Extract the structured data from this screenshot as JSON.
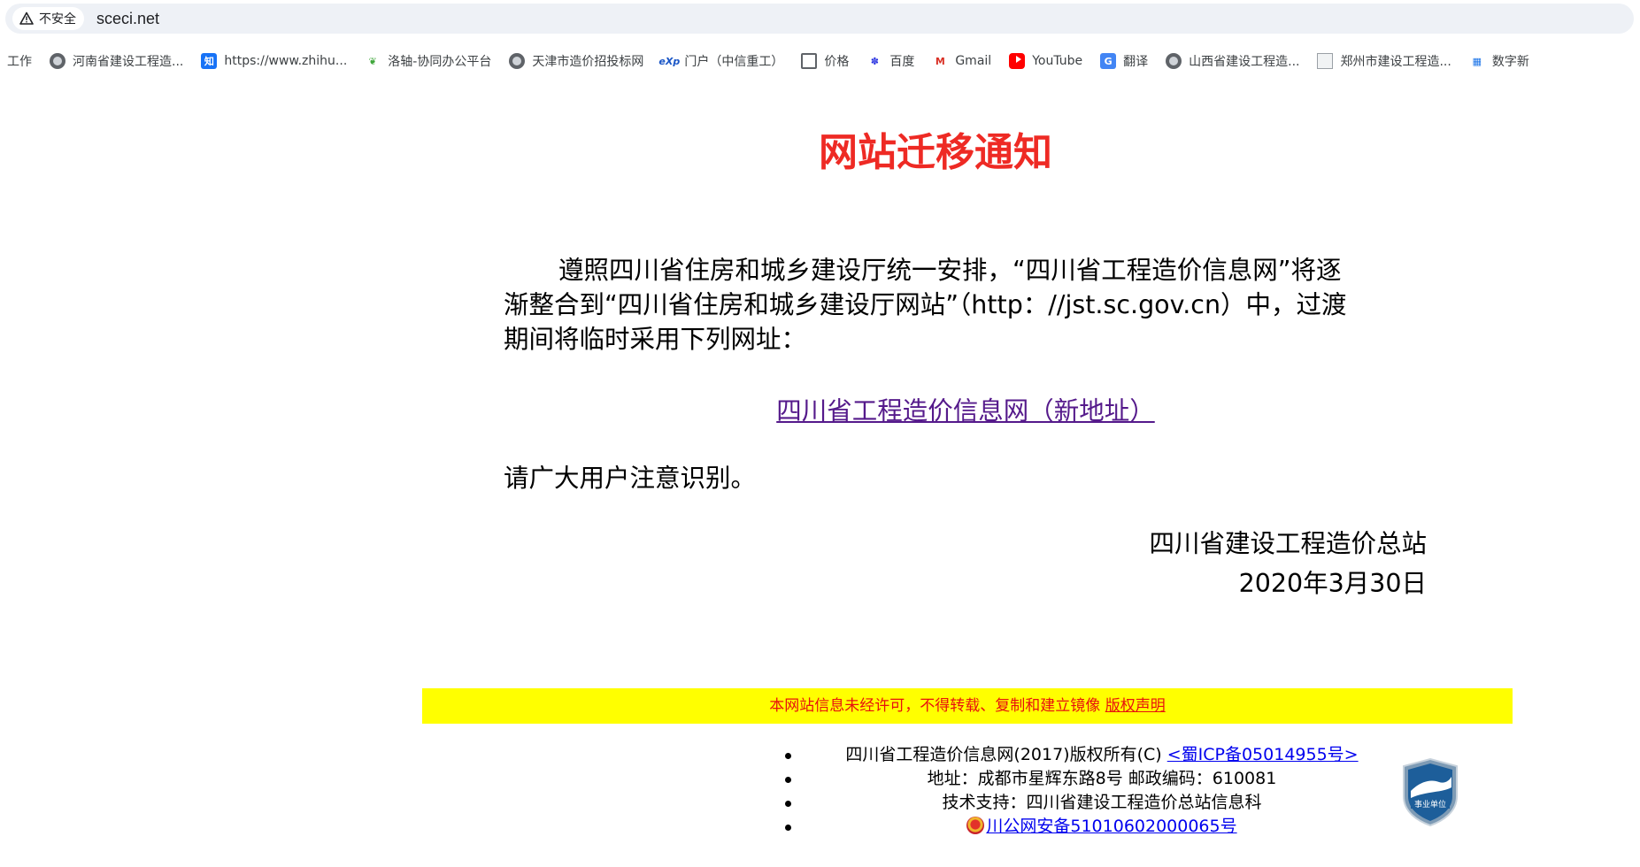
{
  "browser": {
    "security_label": "不安全",
    "url": "sceci.net",
    "bookmarks": [
      {
        "label": "工作",
        "icon": "none"
      },
      {
        "label": "河南省建设工程造...",
        "icon": "globe-icon"
      },
      {
        "label": "https://www.zhihu...",
        "icon": "zhihu-icon"
      },
      {
        "label": "洛轴-协同办公平台",
        "icon": "butterfly-icon"
      },
      {
        "label": "天津市造价招投标网",
        "icon": "globe-icon"
      },
      {
        "label": "门户（中信重工）",
        "icon": "exp-icon"
      },
      {
        "label": "价格",
        "icon": "folder-icon"
      },
      {
        "label": "百度",
        "icon": "baidu-icon"
      },
      {
        "label": "Gmail",
        "icon": "gmail-icon"
      },
      {
        "label": "YouTube",
        "icon": "youtube-icon"
      },
      {
        "label": "翻译",
        "icon": "translate-icon"
      },
      {
        "label": "山西省建设工程造...",
        "icon": "globe-icon"
      },
      {
        "label": "郑州市建设工程造...",
        "icon": "document-icon"
      },
      {
        "label": "数字新",
        "icon": "shuzi-icon"
      }
    ]
  },
  "notice": {
    "title": "网站迁移通知",
    "line1": "遵照四川省住房和城乡建设厅统一安排，“四川省工程造价信息网”将逐",
    "line2": "渐整合到“四川省住房和城乡建设厅网站”（http：//jst.sc.gov.cn）中，过渡",
    "line3": "期间将临时采用下列网址：",
    "new_link": "四川省工程造价信息网（新地址）",
    "reminder": "请广大用户注意识别。",
    "signature_org": "四川省建设工程造价总站",
    "signature_date": "2020年3月30日"
  },
  "footer": {
    "banner_text": "本网站信息未经许可，不得转载、复制和建立镜像 ",
    "banner_link": "版权声明",
    "copyright_prefix": "四川省工程造价信息网(2017)版权所有(C) ",
    "icp_link": "<蜀ICP备05014955号>",
    "address": "地址：成都市星辉东路8号  邮政编码：610081",
    "tech_support": "技术支持：四川省建设工程造价总站信息科",
    "police_link": "川公网安备51010602000065号",
    "badge_text": "事业单位"
  },
  "colors": {
    "title_red": "#ee2a24",
    "banner_yellow": "#ffff00",
    "visited_link": "#551a8b",
    "link_blue": "#0000ee"
  }
}
